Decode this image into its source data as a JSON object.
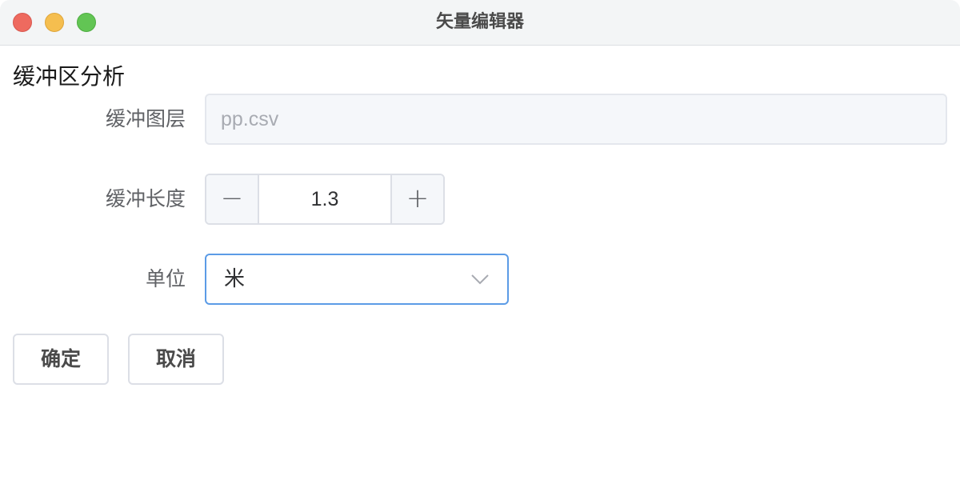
{
  "window": {
    "title": "矢量编辑器"
  },
  "section": {
    "title": "缓冲区分析"
  },
  "form": {
    "buffer_layer": {
      "label": "缓冲图层",
      "value": "pp.csv"
    },
    "buffer_length": {
      "label": "缓冲长度",
      "value": "1.3",
      "decrement_symbol": "−",
      "increment_symbol": "+"
    },
    "unit": {
      "label": "单位",
      "selected": "米",
      "icon": "chevron-down-icon"
    }
  },
  "actions": {
    "confirm_label": "确定",
    "cancel_label": "取消"
  },
  "colors": {
    "focus_border": "#5b9be6",
    "close": "#ee6a5f",
    "minimize": "#f5be4f",
    "zoom": "#62c554"
  }
}
